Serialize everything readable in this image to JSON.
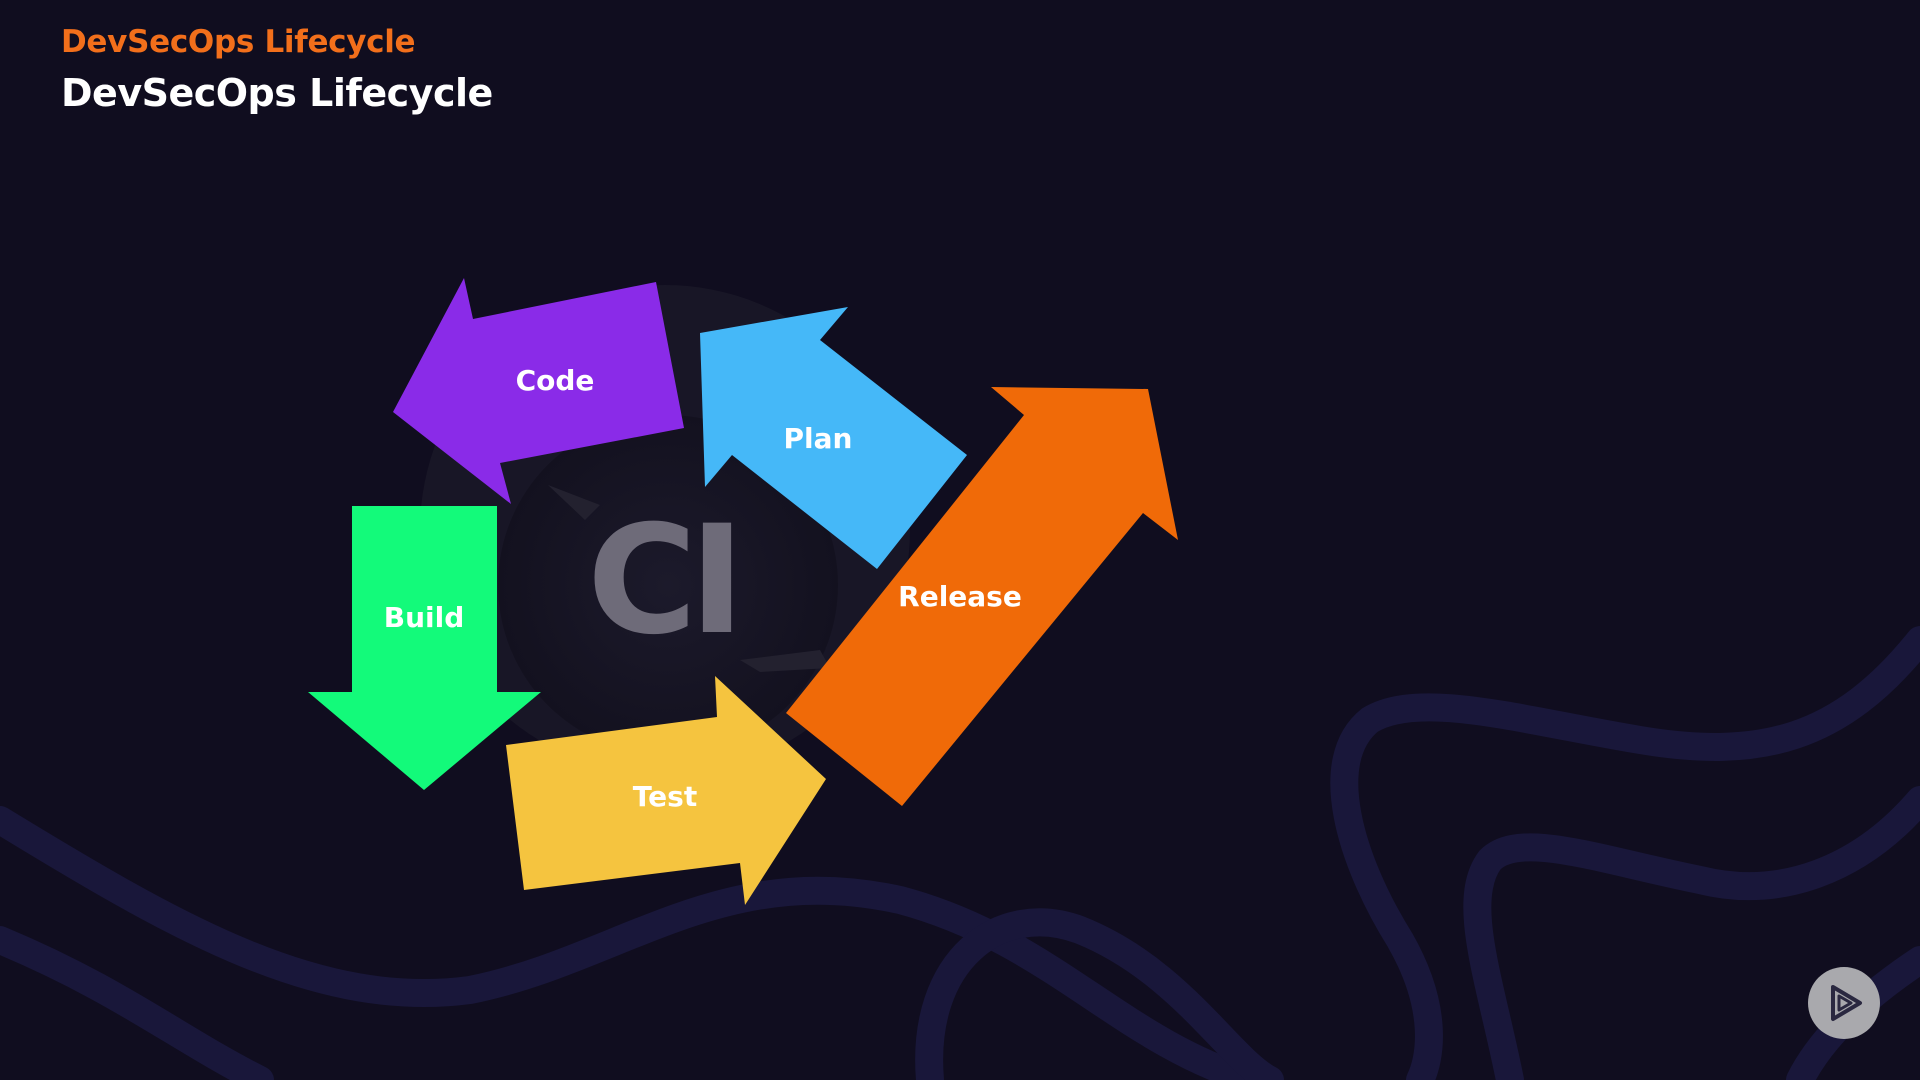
{
  "header": {
    "course_title": "DevSecOps Lifecycle",
    "slide_title": "DevSecOps Lifecycle"
  },
  "diagram": {
    "center_label": "CI",
    "stages": [
      {
        "label": "Code",
        "color": "#8a2be8"
      },
      {
        "label": "Plan",
        "color": "#45b8f8"
      },
      {
        "label": "Build",
        "color": "#13fa7a"
      },
      {
        "label": "Test",
        "color": "#f5c43f"
      },
      {
        "label": "Release",
        "color": "#f06a08"
      }
    ]
  },
  "colors": {
    "background": "#100d1f",
    "accent": "#f26f1b",
    "wave": "#19173a"
  },
  "player": {
    "icon": "play-logo-icon"
  }
}
